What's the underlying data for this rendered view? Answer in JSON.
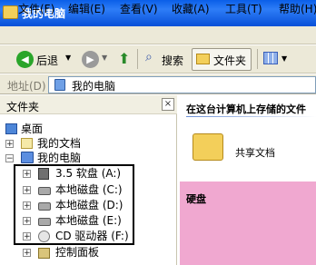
{
  "window": {
    "title": "我的电脑"
  },
  "menu": {
    "file": "文件(F)",
    "edit": "编辑(E)",
    "view": "查看(V)",
    "favorites": "收藏(A)",
    "tools": "工具(T)",
    "help": "帮助(H)"
  },
  "toolbar": {
    "back": "后退",
    "search": "搜索",
    "folders": "文件夹"
  },
  "address": {
    "label": "地址(D)",
    "value": "我的电脑"
  },
  "left_pane": {
    "header": "文件夹",
    "close": "×",
    "nodes": [
      {
        "label": "桌面",
        "icon": "desktop-icon"
      },
      {
        "label": "我的文档",
        "icon": "documents-icon",
        "expander": "+"
      },
      {
        "label": "我的电脑",
        "icon": "computer-icon",
        "expander": "−"
      },
      {
        "label": "3.5 软盘 (A:)",
        "icon": "floppy-icon",
        "expander": "+"
      },
      {
        "label": "本地磁盘 (C:)",
        "icon": "hard-drive-icon",
        "expander": "+"
      },
      {
        "label": "本地磁盘 (D:)",
        "icon": "hard-drive-icon",
        "expander": "+"
      },
      {
        "label": "本地磁盘 (E:)",
        "icon": "hard-drive-icon",
        "expander": "+"
      },
      {
        "label": "CD 驱动器 (F:)",
        "icon": "cd-drive-icon",
        "expander": "+"
      },
      {
        "label": "控制面板",
        "icon": "control-panel-icon",
        "expander": "+"
      }
    ]
  },
  "right_pane": {
    "section_title": "在这台计算机上存储的文件",
    "shared_docs": "共享文档",
    "hard_disks_title": "硬盘"
  },
  "colors": {
    "titlebar": "#0a5fe8",
    "chrome": "#ece9d8",
    "highlight_outline": "#000000",
    "overlay_pink": "#f0a8d0"
  }
}
